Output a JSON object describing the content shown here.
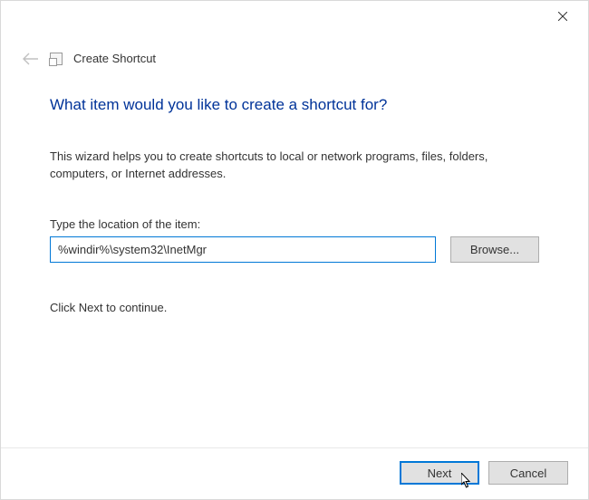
{
  "header": {
    "title": "Create Shortcut"
  },
  "main": {
    "heading": "What item would you like to create a shortcut for?",
    "description": "This wizard helps you to create shortcuts to local or network programs, files, folders, computers, or Internet addresses.",
    "field_label": "Type the location of the item:",
    "location_value": "%windir%\\system32\\InetMgr",
    "browse_label": "Browse...",
    "continue_text": "Click Next to continue."
  },
  "footer": {
    "next_label": "Next",
    "cancel_label": "Cancel"
  }
}
